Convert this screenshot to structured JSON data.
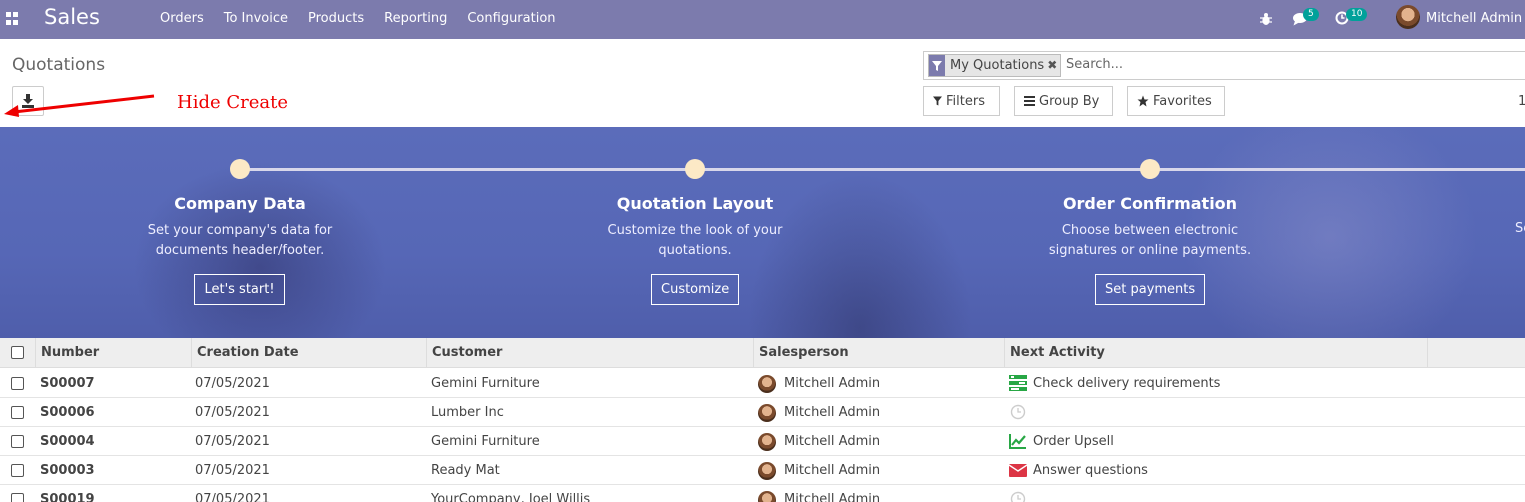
{
  "navbar": {
    "app_name": "Sales",
    "menu": [
      "Orders",
      "To Invoice",
      "Products",
      "Reporting",
      "Configuration"
    ],
    "messages_count": "5",
    "activities_count": "10",
    "user_name": "Mitchell Admin",
    "color": "#7c7bad"
  },
  "control_panel": {
    "title": "Quotations",
    "annotation": "Hide Create",
    "annotation_color": "#e00000",
    "facet_label": "My Quotations",
    "search_placeholder": "Search...",
    "filters_label": "Filters",
    "groupby_label": "Group By",
    "favorites_label": "Favorites",
    "pager_peek": "1"
  },
  "banner": {
    "steps": [
      {
        "title": "Company Data",
        "desc_1": "Set your company's data for",
        "desc_2": "documents header/footer.",
        "button": "Let's start!"
      },
      {
        "title": "Quotation Layout",
        "desc_1": "Customize the look of your",
        "desc_2": "quotations.",
        "button": "Customize"
      },
      {
        "title": "Order Confirmation",
        "desc_1": "Choose between electronic",
        "desc_2": "signatures or online payments.",
        "button": "Set payments"
      }
    ],
    "peek_text": "Se"
  },
  "table": {
    "columns": [
      "Number",
      "Creation Date",
      "Customer",
      "Salesperson",
      "Next Activity"
    ],
    "rows": [
      {
        "number": "S00007",
        "date": "07/05/2021",
        "customer": "Gemini Furniture",
        "salesperson": "Mitchell Admin",
        "activity": "Check delivery requirements",
        "activity_icon": "tasks-icon"
      },
      {
        "number": "S00006",
        "date": "07/05/2021",
        "customer": "Lumber Inc",
        "salesperson": "Mitchell Admin",
        "activity": "",
        "activity_icon": "clock-icon"
      },
      {
        "number": "S00004",
        "date": "07/05/2021",
        "customer": "Gemini Furniture",
        "salesperson": "Mitchell Admin",
        "activity": "Order Upsell",
        "activity_icon": "line-chart-icon"
      },
      {
        "number": "S00003",
        "date": "07/05/2021",
        "customer": "Ready Mat",
        "salesperson": "Mitchell Admin",
        "activity": "Answer questions",
        "activity_icon": "envelope-icon"
      },
      {
        "number": "S00019",
        "date": "07/05/2021",
        "customer": "YourCompany, Joel Willis",
        "salesperson": "Mitchell Admin",
        "activity": "",
        "activity_icon": "clock-icon"
      }
    ]
  }
}
